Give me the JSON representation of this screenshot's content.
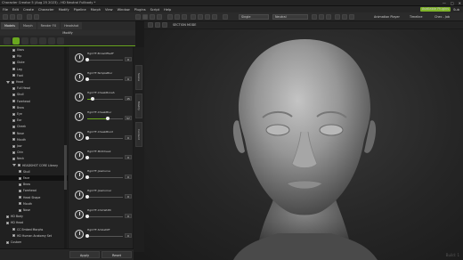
{
  "app": {
    "title": "Character Creator 5 (Aug 25 2023) - HD Neutral Fullbody *",
    "window_controls": [
      "—",
      "□",
      "✕"
    ]
  },
  "menu": {
    "items": [
      "File",
      "Edit",
      "Create",
      "Character",
      "Modify",
      "Pipeline",
      "Morph",
      "View",
      "Window",
      "Plugins",
      "Script",
      "Help"
    ],
    "right": {
      "badge": "Available Plugins",
      "sub": "Sub"
    }
  },
  "toolbar": {
    "select_mode": "Single",
    "view_mode": "Neutral",
    "animation_player": "Animation Player",
    "timeline": "Timeline",
    "check": "Chec - Job"
  },
  "tabs": [
    "Models",
    "Morph",
    "Render FX",
    "Headshot"
  ],
  "panel": {
    "header": "Modify",
    "tree": [
      {
        "label": "Iliacs",
        "indent": 2,
        "checked": true
      },
      {
        "label": "Hip",
        "indent": 2,
        "checked": true
      },
      {
        "label": "Glute",
        "indent": 2,
        "checked": true
      },
      {
        "label": "Leg",
        "indent": 2,
        "checked": true
      },
      {
        "label": "Foot",
        "indent": 2,
        "checked": true
      },
      {
        "label": "Head",
        "indent": 1,
        "checked": true,
        "expanded": true
      },
      {
        "label": "Full Head",
        "indent": 2,
        "checked": true
      },
      {
        "label": "Skull",
        "indent": 2,
        "checked": true
      },
      {
        "label": "Forehead",
        "indent": 2,
        "checked": true
      },
      {
        "label": "Brow",
        "indent": 2,
        "checked": true
      },
      {
        "label": "Eye",
        "indent": 2,
        "checked": true
      },
      {
        "label": "Ear",
        "indent": 2,
        "checked": true
      },
      {
        "label": "Cheek",
        "indent": 2,
        "checked": true
      },
      {
        "label": "Nose",
        "indent": 2,
        "checked": true
      },
      {
        "label": "Mouth",
        "indent": 2,
        "checked": true
      },
      {
        "label": "Jaw",
        "indent": 2,
        "checked": true
      },
      {
        "label": "Chin",
        "indent": 2,
        "checked": true
      },
      {
        "label": "Neck",
        "indent": 2,
        "checked": true
      },
      {
        "label": "HEADSHOT CORE Library",
        "indent": 2,
        "checked": true,
        "expanded": true
      },
      {
        "label": "Skull",
        "indent": 3,
        "checked": true
      },
      {
        "label": "Face",
        "indent": 3,
        "checked": true,
        "selected": true
      },
      {
        "label": "Brow",
        "indent": 3,
        "checked": true
      },
      {
        "label": "Forehead",
        "indent": 3,
        "checked": true
      },
      {
        "label": "Head Shape",
        "indent": 3,
        "checked": true
      },
      {
        "label": "Mouth",
        "indent": 3,
        "checked": true
      },
      {
        "label": "Nose",
        "indent": 3,
        "checked": true
      },
      {
        "label": "HD Body",
        "indent": 1,
        "checked": true
      },
      {
        "label": "HD Head",
        "indent": 1,
        "checked": true
      },
      {
        "label": "CC Embed Morphs",
        "indent": 2,
        "checked": true
      },
      {
        "label": "HD Human Anatomy Set",
        "indent": 2,
        "checked": true
      },
      {
        "label": "Custom",
        "indent": 1,
        "checked": true
      }
    ],
    "sliders": [
      {
        "label": "HgmTF-BrowOffsetF",
        "value": "0",
        "fraction": 0.0
      },
      {
        "label": "HgmTF-TempleBlur",
        "value": "0",
        "fraction": 0.0
      },
      {
        "label": "HgmTF-CheekBoneS",
        "value": "15",
        "fraction": 0.15
      },
      {
        "label": "HgmTF-CheekBlur",
        "value": "57",
        "fraction": 0.57
      },
      {
        "label": "HgmTF-CheekBlur2",
        "value": "0",
        "fraction": 0.0
      },
      {
        "label": "HgmTF-MidCheek",
        "value": "0",
        "fraction": 0.0
      },
      {
        "label": "HgmTF-JawCurve",
        "value": "0",
        "fraction": 0.0
      },
      {
        "label": "HgmTF-JawCorner",
        "value": "0",
        "fraction": 0.0
      },
      {
        "label": "HgmTF-ChinWidth",
        "value": "0",
        "fraction": 0.0
      },
      {
        "label": "HgmTF-SmileDiff",
        "value": "0",
        "fraction": 0.0
      }
    ],
    "side_tabs": [
      "Scene",
      "Modify",
      "Content"
    ],
    "footer": {
      "apply": "Apply",
      "reset": "Reset"
    }
  },
  "viewport": {
    "tool_label": "SECTION MODE",
    "watermark": "Build: 1"
  }
}
